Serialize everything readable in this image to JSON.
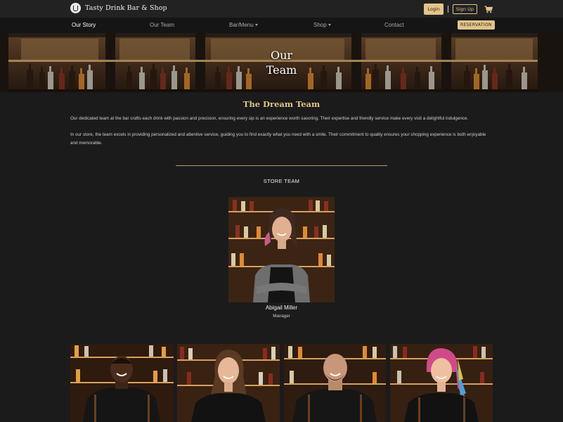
{
  "header": {
    "brand": "Tasty Drink Bar & Shop",
    "logo_icon": "cup-logo-icon",
    "login_label": "Login",
    "signup_label": "Sign Up",
    "cart_icon": "cart-icon"
  },
  "nav": {
    "items": [
      {
        "label": "Our Story",
        "active": true
      },
      {
        "label": "Our Team",
        "active": false
      },
      {
        "label": "Bar/Menu",
        "dropdown": true
      },
      {
        "label": "Shop",
        "dropdown": true
      },
      {
        "label": "Contact",
        "active": false
      }
    ],
    "reservation_label": "RESERVATION"
  },
  "hero": {
    "title_line1": "Our",
    "title_line2": "Team"
  },
  "intro": {
    "heading": "The Dream Team",
    "paragraph1": "Our dedicated team at the bar crafts each drink with passion and precision, ensuring every sip is an experience worth savoring. Their expertise and friendly service make every visit a delightful indulgence.",
    "paragraph2": "In our store, the team excels in providing personalized and attentive service, guiding you to find exactly what you need with a smile. Their commitment to quality ensures your shopping experience is both enjoyable and memorable."
  },
  "store_team": {
    "heading": "STORE TEAM",
    "manager": {
      "name": "Abigail Miller",
      "role": "Manager"
    }
  },
  "colors": {
    "accent": "#e3c48a",
    "background": "#1b1b1b",
    "topbar": "#222222",
    "navbar": "#151515"
  }
}
